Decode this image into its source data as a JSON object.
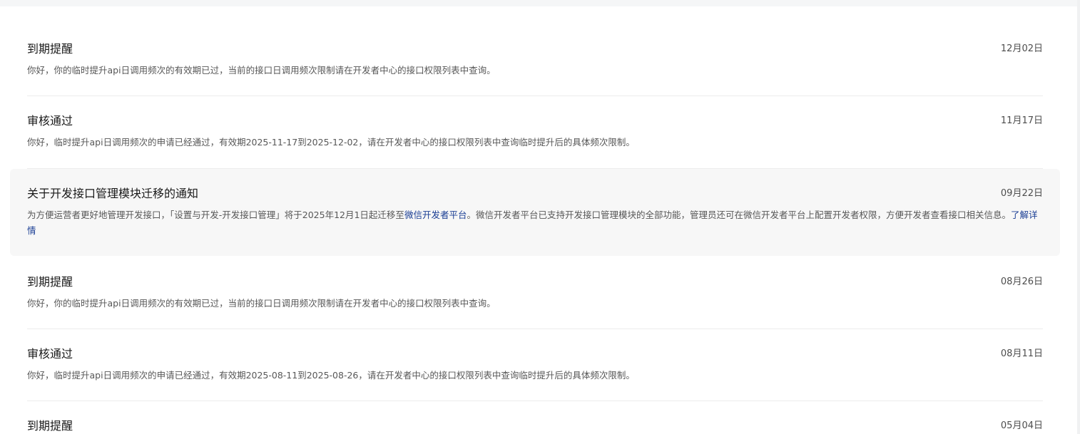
{
  "notifications": [
    {
      "title": "到期提醒",
      "date": "12月02日",
      "desc": "你好，你的临时提升api日调用频次的有效期已过，当前的接口日调用频次限制请在开发者中心的接口权限列表中查询。"
    },
    {
      "title": "审核通过",
      "date": "11月17日",
      "desc": "你好，临时提升api日调用频次的申请已经通过，有效期2025-11-17到2025-12-02，请在开发者中心的接口权限列表中查询临时提升后的具体频次限制。"
    },
    {
      "title": "关于开发接口管理模块迁移的通知",
      "date": "09月22日",
      "desc_part1": "为方便运营者更好地管理开发接口，「设置与开发-开发接口管理」将于2025年12月1日起迁移至",
      "desc_link1": "微信开发者平台",
      "desc_part2": "。微信开发者平台已支持开发接口管理模块的全部功能，管理员还可在微信开发者平台上配置开发者权限，方便开发者查看接口相关信息。",
      "desc_link2": "了解详情"
    },
    {
      "title": "到期提醒",
      "date": "08月26日",
      "desc": "你好，你的临时提升api日调用频次的有效期已过，当前的接口日调用频次限制请在开发者中心的接口权限列表中查询。"
    },
    {
      "title": "审核通过",
      "date": "08月11日",
      "desc": "你好，临时提升api日调用频次的申请已经通过，有效期2025-08-11到2025-08-26，请在开发者中心的接口权限列表中查询临时提升后的具体频次限制。"
    },
    {
      "title": "到期提醒",
      "date": "05月04日"
    }
  ]
}
